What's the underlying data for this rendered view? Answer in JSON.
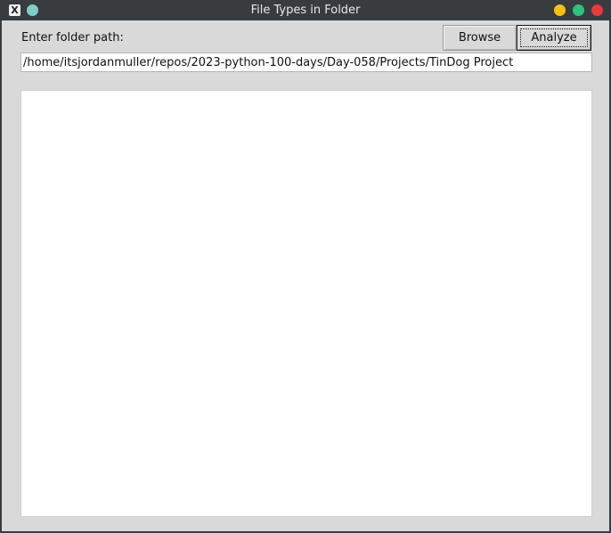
{
  "window": {
    "title": "File Types in Folder",
    "app_icon_glyph": "X",
    "controls": {
      "minimize_color": "#f5c211",
      "maximize_color": "#2ec27e",
      "close_color": "#e53b3b",
      "sticky_color": "#7fcfc7"
    }
  },
  "form": {
    "folder_label": "Enter folder path:",
    "folder_path_value": "/home/itsjordanmuller/repos/2023-python-100-days/Day-058/Projects/TinDog Project",
    "browse_label": "Browse",
    "analyze_label": "Analyze"
  },
  "results": {
    "text": ""
  }
}
